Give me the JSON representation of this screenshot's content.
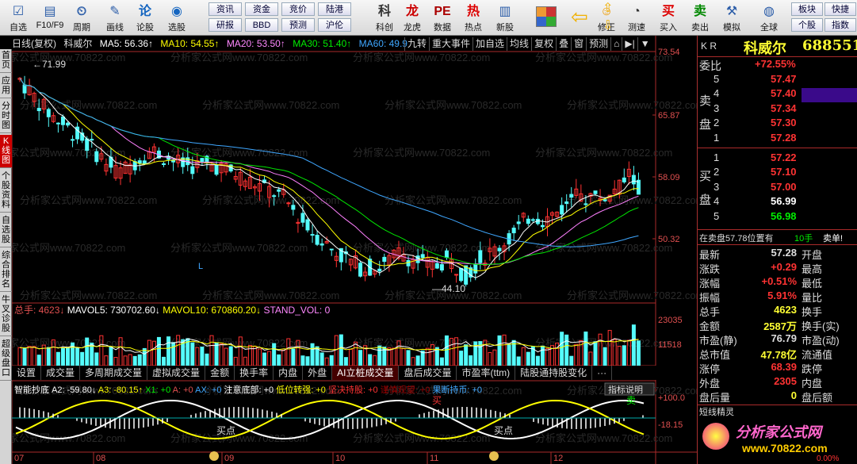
{
  "toolbar": {
    "items": [
      {
        "label": "自选",
        "icon": "checkbox-icon"
      },
      {
        "label": "F10/F9",
        "icon": "f10-icon"
      },
      {
        "label": "周期",
        "icon": "clock-icon"
      },
      {
        "label": "画线",
        "icon": "pencil-icon"
      },
      {
        "label": "论股",
        "icon": "chat-icon"
      },
      {
        "label": "选股",
        "icon": "gauge-icon"
      },
      {
        "label": "科创",
        "icon": "kc-icon"
      },
      {
        "label": "龙虎",
        "icon": "dragon-icon"
      },
      {
        "label": "数据",
        "icon": "pe-icon"
      },
      {
        "label": "热点",
        "icon": "hot-icon"
      },
      {
        "label": "新股",
        "icon": "doc-icon"
      },
      {
        "label": "修正",
        "icon": "smile-icon"
      },
      {
        "label": "测速",
        "icon": "speed-icon"
      },
      {
        "label": "买入",
        "icon": "buy-icon"
      },
      {
        "label": "卖出",
        "icon": "sell-icon"
      },
      {
        "label": "模拟",
        "icon": "hammer-icon"
      },
      {
        "label": "全球",
        "icon": "globe-icon"
      }
    ],
    "small": [
      [
        "资讯",
        "资金",
        "竞价",
        "陆港"
      ],
      [
        "研报",
        "BBD",
        "预测",
        "沪伦"
      ]
    ],
    "right_small": [
      [
        "板块",
        "快捷"
      ],
      [
        "个股",
        "指数"
      ]
    ],
    "buy_glyph": "买",
    "sell_glyph": "卖"
  },
  "left_tabs": [
    "首页",
    "应用",
    "分时图",
    "K线图",
    "个股资料",
    "自选股",
    "综合排名",
    "牛叉诊股",
    "超级盘口"
  ],
  "header": {
    "title": "日线(复权)",
    "name": "科威尔",
    "ma5": "MA5: 56.36↑",
    "ma10": "MA10: 54.55↑",
    "ma20": "MA20: 53.50↑",
    "ma30": "MA30: 51.40↑",
    "ma60": "MA60: 49.9"
  },
  "chart_tools": [
    "九转",
    "重大事件",
    "加自选",
    "均线",
    "复权",
    "叠",
    "窗",
    "预测",
    "⌂",
    "▶|",
    "▼"
  ],
  "price_axis": [
    "73.54",
    "65.87",
    "58.09",
    "50.32"
  ],
  "vol_axis": [
    "23035",
    "11518"
  ],
  "osc_axis": [
    "+100.0",
    "-18.15"
  ],
  "annotations": {
    "high": "71.99",
    "low": "44.10",
    "L": "L",
    "buy1": "买点",
    "buy2": "买点",
    "sell": "买",
    "buy3": "卖"
  },
  "vol_header": {
    "total": "总手: 4623↓",
    "mavol5": "MAVOL5: 730702.60↓",
    "mavol10": "MAVOL10: 670860.20↓",
    "stand": "STAND_VOL: 0"
  },
  "ind_tabs": [
    "设置",
    "成交量",
    "多周期成交量",
    "虚拟成交量",
    "金额",
    "换手率",
    "内盘",
    "外盘",
    "AI立桩成交量",
    "盘后成交量",
    "市盈率(ttm)",
    "陆股通持股变化",
    "···"
  ],
  "osc_header": {
    "name": "智能抄底",
    "a2": "A2: -59.80↓",
    "a3": "A3: -80.15↑",
    "x1": "X1: +0",
    "a": "A: +0",
    "ax": "AX: +0",
    "b1": "注意底部: +0",
    "b2": "低位转强: +0",
    "b3": "坚决持股: +0",
    "b4": "谨慎观望: +0",
    "b5": "果断持币: +0",
    "help": "指标说明"
  },
  "months": [
    "07",
    "08",
    "09",
    "10",
    "11",
    "12"
  ],
  "watermark": "分析家公式网www.70822.com",
  "quote": {
    "kr": "K R",
    "name": "科威尔",
    "code": "688551",
    "weibi_label": "委比",
    "weibi": "+72.55%",
    "sell_label": "卖盘",
    "buy_label": "买盘",
    "sells": [
      {
        "n": "5",
        "p": "57.47",
        "v": ""
      },
      {
        "n": "4",
        "p": "57.40",
        "v": ""
      },
      {
        "n": "3",
        "p": "57.34",
        "v": ""
      },
      {
        "n": "2",
        "p": "57.30",
        "v": ""
      },
      {
        "n": "1",
        "p": "57.28",
        "v": ""
      }
    ],
    "buys": [
      {
        "n": "1",
        "p": "57.22",
        "v": ""
      },
      {
        "n": "2",
        "p": "57.10",
        "v": ""
      },
      {
        "n": "3",
        "p": "57.00",
        "v": ""
      },
      {
        "n": "4",
        "p": "56.99",
        "v": ""
      },
      {
        "n": "5",
        "p": "56.98",
        "v": ""
      }
    ],
    "zai": "在卖盘57.78位置有",
    "zai_vol": "10手",
    "zai_msg": "卖单!",
    "left_rows": [
      [
        "最新",
        "57.28"
      ],
      [
        "涨跌",
        "+0.29"
      ],
      [
        "涨幅",
        "+0.51%"
      ],
      [
        "振幅",
        "5.91%"
      ],
      [
        "总手",
        "4623"
      ],
      [
        "金额",
        "2587万"
      ],
      [
        "市盈(静)",
        "76.79"
      ],
      [
        "总市值",
        "47.78亿"
      ],
      [
        "涨停",
        "68.39"
      ],
      [
        "外盘",
        "2305"
      ],
      [
        "盘后量",
        "0"
      ]
    ],
    "right_rows": [
      "开盘",
      "最高",
      "最低",
      "量比",
      "换手",
      "换手(实)",
      "市盈(动)",
      "流通值",
      "跌停",
      "内盘",
      "盘后额"
    ],
    "short": "短线精灵",
    "logo": "分析家公式网",
    "logo_url": "www.70822.com",
    "bottom": "0.00%"
  },
  "colors": {
    "up": "#ff3232",
    "down": "#54fcfc",
    "ma5": "#ffffff",
    "ma10": "#ffff00",
    "ma20": "#ff80ff",
    "ma30": "#00e600",
    "ma60": "#3fa7ff"
  }
}
